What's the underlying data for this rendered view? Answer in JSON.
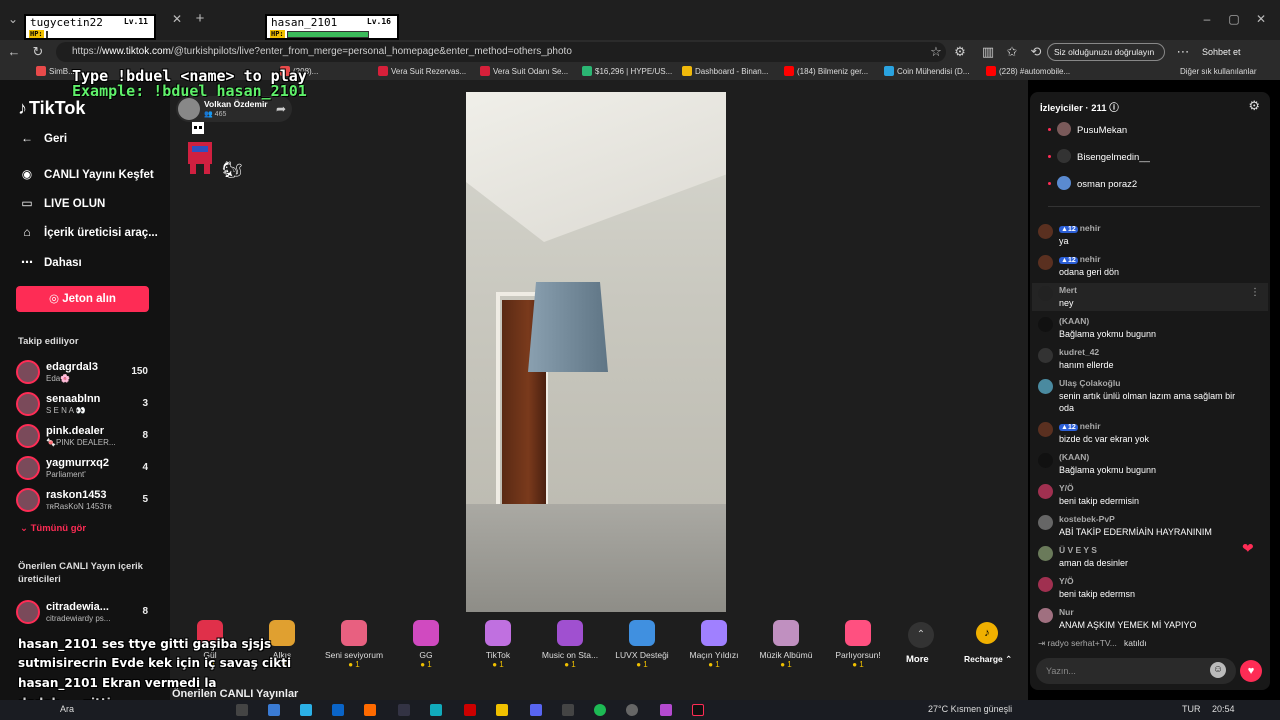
{
  "hp_boxes": [
    {
      "name": "tugycetin22",
      "level": "Lv.11",
      "hp": "HP:"
    },
    {
      "name": "hasan_2101",
      "level": "Lv.16",
      "hp": "HP:"
    }
  ],
  "browser": {
    "url_prefix": "https://",
    "url_host": "www.tiktok.com",
    "url_rest": "/@turkishpilots/live?enter_from_merge=personal_homepage&enter_method=others_photo",
    "verify_label": "Siz olduğunuzu doğrulayın",
    "sohbet_label": "Sohbet et",
    "bookmarks": [
      {
        "label": "SimB...",
        "color": "#e84a4a"
      },
      {
        "label": "(208)...",
        "color": "#e84a4a"
      },
      {
        "label": "Vera Suit Rezervas...",
        "color": "#d6203a"
      },
      {
        "label": "Vera Suit Odanı Se...",
        "color": "#d6203a"
      },
      {
        "label": "$16,296 | HYPE/US...",
        "color": "#2bb673"
      },
      {
        "label": "Dashboard - Binan...",
        "color": "#f0b90b"
      },
      {
        "label": "(184) Bilmeniz ger...",
        "color": "#ff0000"
      },
      {
        "label": "Coin Mühendisi (D...",
        "color": "#2aa3e0"
      },
      {
        "label": "(228) #automobile...",
        "color": "#ff0000"
      }
    ],
    "other_bookmarks": "Diğer sık kullanılanlar"
  },
  "overlay": {
    "type_line": "Type !bduel <name> to play",
    "example_line": "Example: !bduel hasan_2101"
  },
  "sidebar": {
    "logo": "TikTok",
    "back": "Geri",
    "nav": [
      {
        "label": "CANLI Yayını Keşfet",
        "icon": "live-explore-icon"
      },
      {
        "label": "LIVE OLUN",
        "icon": "camera-icon"
      },
      {
        "label": "İçerik üreticisi araç...",
        "icon": "home-icon"
      },
      {
        "label": "Dahası",
        "icon": "more-icon"
      }
    ],
    "jeton": "Jeton alın",
    "following_title": "Takip ediliyor",
    "following": [
      {
        "name": "edagrdal3",
        "sub": "Eda🌸",
        "count": "150"
      },
      {
        "name": "senaablnn",
        "sub": "S E N A 👀",
        "count": "3"
      },
      {
        "name": "pink.dealer",
        "sub": "🍬PINK DEALER...",
        "count": "8"
      },
      {
        "name": "yagmurrxq2",
        "sub": "Parliament'",
        "count": "4"
      },
      {
        "name": "raskon1453",
        "sub": "ᴛʀRasKoN 1453ᴛʀ",
        "count": "5"
      }
    ],
    "see_all": "Tümünü gör",
    "suggested_title": "Önerilen CANLI Yayın içerik üreticileri",
    "suggested": [
      {
        "name": "citradewia...",
        "sub": "citradewiardy ps...",
        "count": "8"
      }
    ]
  },
  "stream": {
    "host_name": "Volkan Özdemir",
    "host_viewers": "465",
    "gifts": [
      {
        "label": "Gül",
        "price": "1",
        "color": "#e0304a"
      },
      {
        "label": "Alkış",
        "price": "1",
        "color": "#e0a030"
      },
      {
        "label": "Seni seviyorum",
        "price": "1",
        "color": "#e86080"
      },
      {
        "label": "GG",
        "price": "1",
        "color": "#d04ac0"
      },
      {
        "label": "TikTok",
        "price": "1",
        "color": "#c070e0"
      },
      {
        "label": "Music on Sta...",
        "price": "1",
        "color": "#a050d0"
      },
      {
        "label": "LUVX Desteği",
        "price": "1",
        "color": "#4090e0"
      },
      {
        "label": "Maçın Yıldızı",
        "price": "1",
        "color": "#a080ff"
      },
      {
        "label": "Müzik Albümü",
        "price": "1",
        "color": "#c090c0"
      },
      {
        "label": "Parlıyorsun!",
        "price": "1",
        "color": "#ff5080"
      }
    ],
    "more": "More",
    "recharge": "Recharge",
    "bottom_heading": "Önerilen CANLI Yayınlar"
  },
  "chat": {
    "header": "İzleyiciler",
    "viewer_count": "211",
    "viewers": [
      {
        "name": "PusuMekan",
        "color": "#7a5a5a"
      },
      {
        "name": "Bisengelmedin__",
        "color": "#333333"
      },
      {
        "name": "osman poraz2",
        "color": "#5a8ad0"
      }
    ],
    "messages": [
      {
        "user": "nehir",
        "level": "12",
        "text": "ya",
        "color": "#5a3020"
      },
      {
        "user": "nehir",
        "level": "12",
        "text": "odana geri dön",
        "color": "#5a3020"
      },
      {
        "user": "Mert",
        "level": "",
        "text": "ney",
        "color": "#222222"
      },
      {
        "user": "(KAAN)",
        "level": "",
        "text": "Bağlama yokmu bugunn",
        "color": "#111111"
      },
      {
        "user": "kudret_42",
        "level": "",
        "text": "hanım ellerde",
        "color": "#333333"
      },
      {
        "user": "Ulaş Çolakoğlu",
        "level": "",
        "text": "senin artık ünlü olman lazım ama sağlam bir oda",
        "color": "#4a8aa0"
      },
      {
        "user": "nehir",
        "level": "12",
        "text": "bizde dc var ekran yok",
        "color": "#5a3020"
      },
      {
        "user": "(KAAN)",
        "level": "",
        "text": "Bağlama yokmu bugunn",
        "color": "#111111"
      },
      {
        "user": "Y/Ö",
        "level": "",
        "text": "beni takip edermisin",
        "color": "#a03050"
      },
      {
        "user": "kostebek-PvP",
        "level": "",
        "text": "ABİ TAKİP EDERMİAİN HAYRANINIM",
        "color": "#666666"
      },
      {
        "user": "Ü V E Y S",
        "level": "",
        "text": "aman da desinler",
        "color": "#6a7a5a"
      },
      {
        "user": "Y/Ö",
        "level": "",
        "text": "beni takip edermsn",
        "color": "#a03050"
      },
      {
        "user": "Nur",
        "level": "",
        "text": "ANAM AŞKIM YEMEK Mİ YAPIYO",
        "color": "#a07080"
      }
    ],
    "join_user": "radyo serhat+TV...",
    "join_text": "katıldı",
    "input_placeholder": "Yazın..."
  },
  "overlay_chat": [
    "hasan_2101 ses ttye gitti gaşiba sjsjs",
    "sutmisirecrin Evde kek için iç savaş cikti",
    "hasan_2101 Ekran vermedi la",
    "dedeh.... gitti"
  ],
  "taskbar": {
    "search": "Ara",
    "weather": "27°C  Kısmen güneşli",
    "lang": "TUR",
    "time": "20:54"
  }
}
